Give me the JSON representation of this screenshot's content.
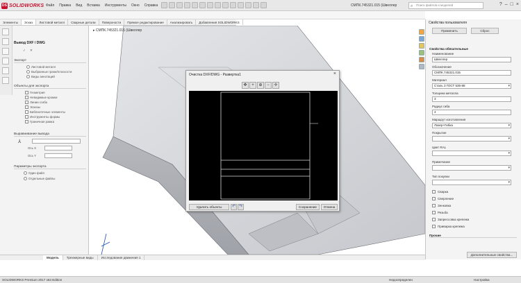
{
  "app": {
    "brand": "SOLIDWORKS",
    "doc_title": "СМПК.745321.015 (Швеллер",
    "search_placeholder": "Поиск файлов и моделей"
  },
  "menu": [
    "Файл",
    "Правка",
    "Вид",
    "Вставка",
    "Инструменты",
    "Окно",
    "Справка"
  ],
  "tabs": [
    {
      "label": "Элементы",
      "active": false
    },
    {
      "label": "Эскиз",
      "active": true
    },
    {
      "label": "Листовой металл",
      "active": false
    },
    {
      "label": "Сварные детали",
      "active": false
    },
    {
      "label": "Поверхности",
      "active": false
    },
    {
      "label": "Прямое редактирование",
      "active": false
    },
    {
      "label": "Анализировать",
      "active": false
    },
    {
      "label": "Добавления SOLIDWORKS",
      "active": false
    }
  ],
  "left_panel": {
    "title": "Вывод DXF / DWG",
    "export_section": "Экспорт",
    "export_items": [
      "Листовой металл",
      "Выбранные грани/плоскости",
      "Виды аннотаций"
    ],
    "objects_section": "Объекты для экспорта",
    "objects_items": [
      "Геометрия",
      "Невидимые кромки",
      "Линии сгиба",
      "Эскизы",
      "Библиотечные элементы",
      "Инструменты формы",
      "Граничная рамка"
    ],
    "align_section": "Выравнивание вывода",
    "align_fields": [
      "Ось X",
      "Ось Y"
    ],
    "params_section": "Параметры экспорта",
    "params_items": [
      "Один файл",
      "Отдельные файлы"
    ]
  },
  "viewport": {
    "tree_label": "СМПК.745321.015 (Швеллер"
  },
  "dialog": {
    "title": "Очистка DXF/DWG - Развертка1",
    "delete_button": "Удалить объекты",
    "save_button": "Сохранение",
    "cancel_button": "Отмена"
  },
  "right_pane": {
    "title": "Свойства пользователя",
    "apply_button": "Применить",
    "reset_button": "Сброс",
    "group": "Свойства обязательные",
    "fields": [
      {
        "label": "Наименование",
        "value": "Швеллер",
        "dropdown": false
      },
      {
        "label": "Обозначение",
        "value": "СМПК.745321.015",
        "dropdown": false
      },
      {
        "label": "Материал",
        "value": "Сталь 3 ГОСТ 535-88",
        "dropdown": true
      },
      {
        "label": "Толщина металла",
        "value": "3",
        "dropdown": false
      },
      {
        "label": "Радиус гиба",
        "value": "4",
        "dropdown": false
      },
      {
        "label": "Маршрут изготовления",
        "value": "Лазер+Гибка",
        "dropdown": true
      },
      {
        "label": "Покрытие",
        "value": "",
        "dropdown": true
      },
      {
        "label": "Цвет RAL",
        "value": "",
        "dropdown": true
      },
      {
        "label": "Примечание",
        "value": "",
        "dropdown": true
      },
      {
        "label": "Тип покупки",
        "value": "",
        "dropdown": true
      }
    ],
    "checks": [
      "Сварка",
      "Сверление",
      "Зенковка",
      "Резьба",
      "Запрессовка крепежа",
      "Приварка крепежа"
    ],
    "other_section": "Прочие",
    "more_button": "Дополнительные свойства..."
  },
  "bottom_tabs": [
    {
      "label": "Модель",
      "active": true
    },
    {
      "label": "Трехмерные виды",
      "active": false
    },
    {
      "label": "Исследование движения 1",
      "active": false
    }
  ],
  "status": {
    "left": "SOLIDWORKS Premium 2017 x64 Edition",
    "mid": "Недоопределен",
    "right": "Настройка"
  }
}
